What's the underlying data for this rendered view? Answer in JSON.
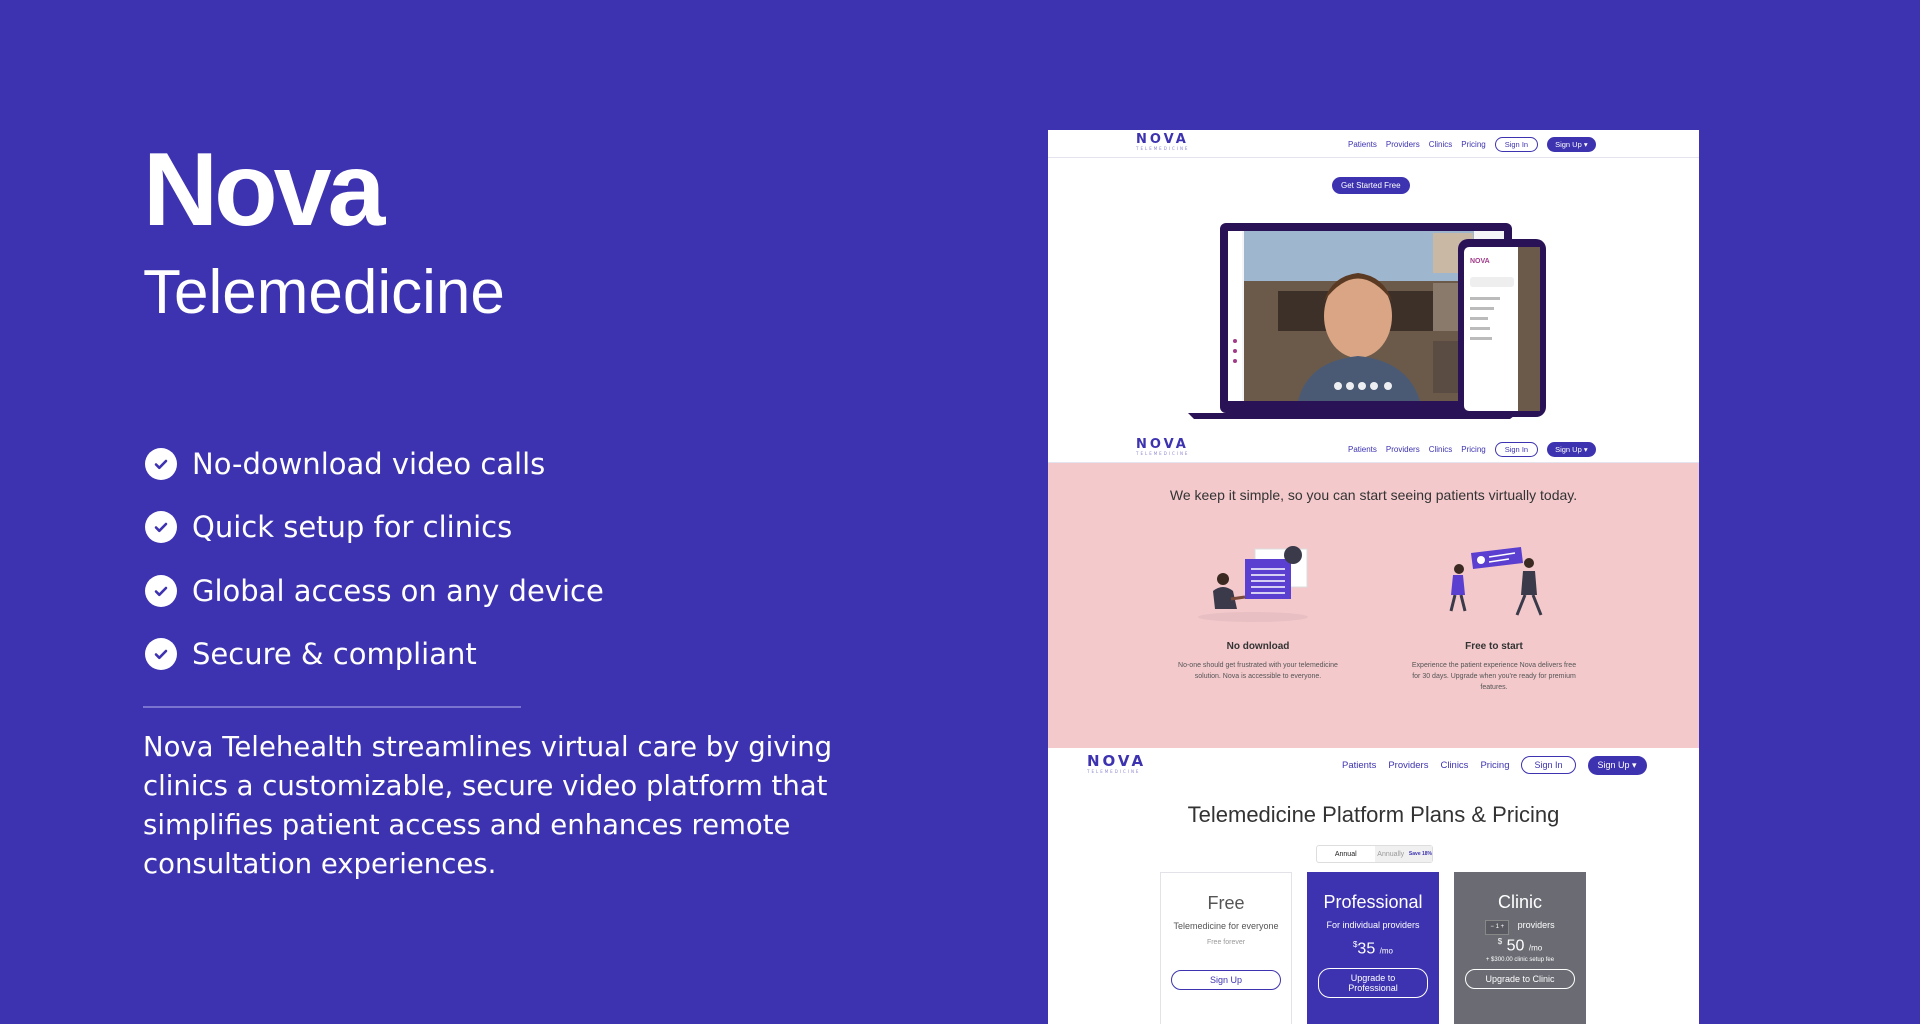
{
  "brand": {
    "title": "Nova",
    "subtitle": "Telemedicine"
  },
  "features": [
    "No-download video calls",
    "Quick setup for clinics",
    "Global access on any device",
    "Secure & compliant"
  ],
  "description": "Nova Telehealth streamlines virtual care by giving clinics a customizable, secure video platform that simplifies patient access and enhances remote consultation experiences.",
  "nav": {
    "logo": "NOVA",
    "logo_sub": "TELEMEDICINE",
    "links": [
      "Patients",
      "Providers",
      "Clinics",
      "Pricing"
    ],
    "sign_in": "Sign In",
    "sign_up": "Sign Up ▾"
  },
  "hero": {
    "cta": "Get Started Free"
  },
  "simple": {
    "title": "We keep it simple, so you can start seeing patients virtually today.",
    "items": [
      {
        "title": "No download",
        "text": "No-one should get frustrated with your telemedicine solution. Nova is accessible to everyone."
      },
      {
        "title": "Free to start",
        "text": "Experience the patient experience Nova delivers free for 30 days. Upgrade when you're ready for premium features."
      }
    ]
  },
  "pricing": {
    "title": "Telemedicine Platform Plans & Pricing",
    "toggle": {
      "annual": "Annual",
      "annually": "Annually",
      "save": "Save 18%"
    },
    "plans": [
      {
        "name": "Free",
        "sub": "Telemedicine for everyone",
        "note": "Free forever",
        "button": "Sign Up"
      },
      {
        "name": "Professional",
        "sub": "For individual providers",
        "currency": "$",
        "price": "35",
        "per": "/mo",
        "button": "Upgrade to Professional"
      },
      {
        "name": "Clinic",
        "stepper": "1",
        "stepper_minus": "−",
        "stepper_plus": "+",
        "sub": "providers",
        "currency": "$",
        "price": "50",
        "per": "/mo",
        "note": "+ $300.00 clinic setup fee",
        "button": "Upgrade to Clinic"
      }
    ]
  },
  "colors": {
    "background": "#3d33b0",
    "accent": "#3d33b0",
    "pink": "#f3c9cc",
    "professional": "#3d33b0",
    "clinic": "#6a6b73"
  }
}
